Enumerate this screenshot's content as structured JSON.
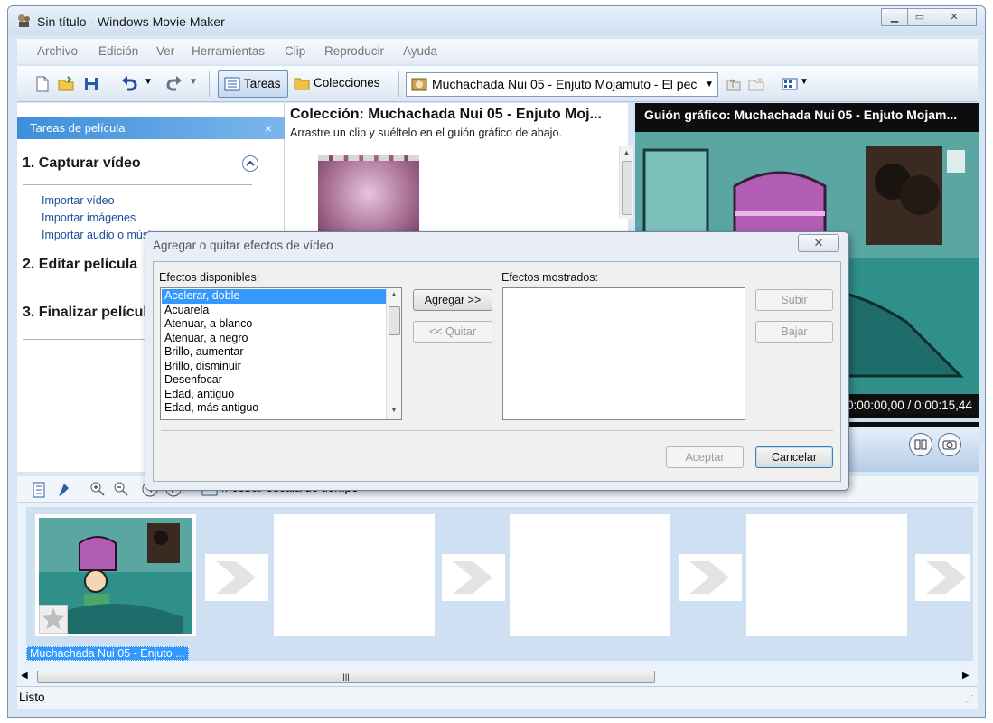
{
  "window": {
    "title": "Sin título - Windows Movie Maker"
  },
  "menu": [
    "Archivo",
    "Edición",
    "Ver",
    "Herramientas",
    "Clip",
    "Reproducir",
    "Ayuda"
  ],
  "toolbar": {
    "tasks_label": "Tareas",
    "collections_label": "Colecciones",
    "collection_value": "Muchachada Nui 05 - Enjuto Mojamuto - El pec"
  },
  "task_pane": {
    "header": "Tareas de película",
    "close": "×",
    "sections": [
      "1. Capturar vídeo",
      "2. Editar película",
      "3. Finalizar película"
    ],
    "links": [
      "Importar vídeo",
      "Importar imágenes",
      "Importar audio o música"
    ]
  },
  "collection": {
    "title": "Colección: Muchachada Nui 05 - Enjuto Moj...",
    "subtitle": "Arrastre un clip y suéltelo en el guión gráfico de abajo."
  },
  "preview": {
    "title": "Guión gráfico: Muchachada Nui 05 - Enjuto Mojam...",
    "time": "0:00:00,00 / 0:00:15,44"
  },
  "storyboard": {
    "show_timeline": "Mostrar escala de tiempo",
    "clip_label": "Muchachada Nui 05 - Enjuto ..."
  },
  "status": {
    "text": "Listo"
  },
  "dialog": {
    "title": "Agregar o quitar efectos de vídeo",
    "available_label": "Efectos disponibles:",
    "shown_label": "Efectos mostrados:",
    "effects": [
      "Acelerar, doble",
      "Acuarela",
      "Atenuar, a blanco",
      "Atenuar, a negro",
      "Brillo, aumentar",
      "Brillo, disminuir",
      "Desenfocar",
      "Edad, antiguo",
      "Edad, más antiguo"
    ],
    "add_button": "Agregar >>",
    "remove_button": "<< Quitar",
    "up_button": "Subir",
    "down_button": "Bajar",
    "ok_button": "Aceptar",
    "cancel_button": "Cancelar"
  }
}
